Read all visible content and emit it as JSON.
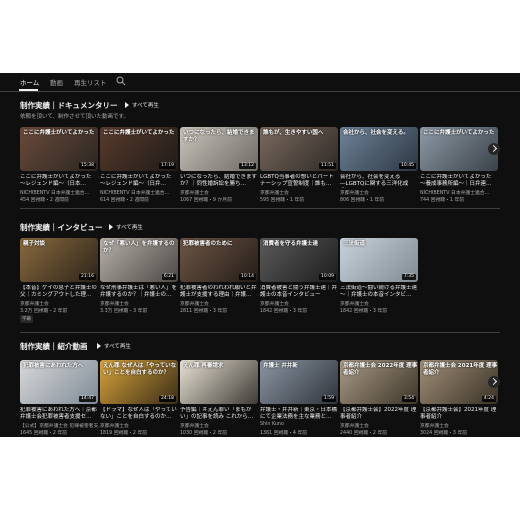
{
  "tabs": [
    {
      "label": "ホーム"
    },
    {
      "label": "動画"
    },
    {
      "label": "再生リスト"
    }
  ],
  "play_all_label": "すべて再生",
  "sections": [
    {
      "title": "制作実績｜ドキュメンタリー",
      "description": "依頼を頂いて、制作させて頂いた動画です。",
      "videos": [
        {
          "thumb_text": "ここに弁護士がいてよかった",
          "duration": "15:38",
          "title": "ここに弁護士がいてよかった ～レジェンド編～（日本…",
          "channel": "NICHIBENTV 日本弁護士連合…",
          "meta": "454 回視聴・2 週間前",
          "colors": [
            "#6b4a3a",
            "#2a2622"
          ]
        },
        {
          "thumb_text": "ここに弁護士がいてよかった",
          "duration": "17:19",
          "title": "ここに弁護士がいてよかった ～レジェンド編～（日弁…",
          "channel": "NICHIBENTV 日本弁護士連合…",
          "meta": "614 回視聴・2 週間前",
          "colors": [
            "#5a3b2c",
            "#1e1b19"
          ]
        },
        {
          "thumb_text": "いつになったら、結婚できますか？",
          "duration": "13:12",
          "title": "いつになったら、結婚できますか？｜同性婚訴訟を勝ち…",
          "channel": "京都弁護士会",
          "meta": "1067 回視聴・9 か月前",
          "colors": [
            "#c9c4bb",
            "#6d6a66"
          ]
        },
        {
          "thumb_text": "誰もが、生きやすい国へ",
          "duration": "11:51",
          "title": "LGBTQ当事者の想いとパートナーシップ宣誓制度｜誰も…",
          "channel": "京都弁護士会",
          "meta": "595 回視聴・1 年前",
          "colors": [
            "#7a6a5e",
            "#2f2a27"
          ]
        },
        {
          "thumb_text": "会社から、社会を変える。",
          "duration": "10:45",
          "title": "会社から、社会を変える―LGBTQに関する三洋化成の…",
          "channel": "京都弁護士会",
          "meta": "806 回視聴・1 年前",
          "colors": [
            "#6f8399",
            "#2c3642"
          ]
        },
        {
          "thumb_text": "ここに弁護士がいてよかった",
          "duration": "",
          "title": "ここに弁護士がいてよかった ～養成事務所編～｜日弁連…",
          "channel": "NICHIBENTV 日本弁護士連合…",
          "meta": "744 回視聴・1 年前",
          "colors": [
            "#8d9aa6",
            "#3a4148"
          ]
        }
      ]
    },
    {
      "title": "制作実績｜インタビュー",
      "description": "",
      "videos": [
        {
          "thumb_text": "親子対談",
          "duration": "21:16",
          "title": "【本音】ゲイの息子と弁護士の父｜カミングアウトした理…",
          "channel": "京都弁護士会",
          "meta": "3.2万 回視聴・2 年前",
          "badge": "字幕",
          "colors": [
            "#8a6a3f",
            "#2c241a"
          ]
        },
        {
          "thumb_text": "なぜ「悪い人」を弁護するのか？",
          "duration": "6:21",
          "title": "なぜ刑事弁護士は「悪い人」を弁護するのか？｜弁護士の…",
          "channel": "京都弁護士会",
          "meta": "3.3万 回視聴・3 年前",
          "colors": [
            "#b7b1aa",
            "#4c4844"
          ]
        },
        {
          "thumb_text": "犯罪被害者のために",
          "duration": "10:14",
          "title": "犯罪被害者のわれわれ願いと弁護士が支援する理由｜弁護…",
          "channel": "京都弁護士会",
          "meta": "2811 回視聴・3 年前",
          "colors": [
            "#6e5646",
            "#241d18"
          ]
        },
        {
          "thumb_text": "消費者を守る弁護士達",
          "duration": "10:09",
          "title": "消費者被害と闘う弁護士達｜弁護士の本音インタビュー",
          "channel": "京都弁護士会",
          "meta": "1842 回視聴・3 年前",
          "colors": [
            "#5b5b5b",
            "#1d1d1d"
          ]
        },
        {
          "thumb_text": "三法街道",
          "duration": "7:35",
          "title": "三法街道～闘い続ける弁護士達～｜弁護士の本音インタビ…",
          "channel": "京都弁護士会",
          "meta": "1842 回視聴・3 年前",
          "colors": [
            "#c9d3dc",
            "#7f8a93"
          ]
        }
      ]
    },
    {
      "title": "制作実績｜紹介動画",
      "description": "",
      "videos": [
        {
          "thumb_text": "犯罪被害にあわれた方へ",
          "duration": "14:47",
          "title": "犯罪被害にあわれた方へ｜京都弁護士会犯罪被害者支援セ…",
          "channel": "【公式】京都弁護士会 犯罪被害者支…",
          "meta": "1645 回視聴・2 年前",
          "colors": [
            "#d9d9d9",
            "#7e8a96"
          ]
        },
        {
          "thumb_text": "えん罪 なぜ人は「やっていない」ことを自白するのか？",
          "duration": "24:18",
          "title": "【ドラマ】なぜ人は「やっていない」ことを自白するのか…",
          "channel": "京都弁護士会",
          "meta": "1819 回視聴・2 年前",
          "colors": [
            "#d8a43b",
            "#3a2d17"
          ]
        },
        {
          "thumb_text": "えん罪 再審請求",
          "duration": "",
          "title": "予告編｜＃えん罪い「まもがい」の記事を読み これから…",
          "channel": "京都弁護士会",
          "meta": "1030 回視聴・2 年前",
          "colors": [
            "#e8e2d4",
            "#3f3b36"
          ]
        },
        {
          "thumb_text": "弁護士 井井新",
          "duration": "1:59",
          "title": "弁護士・井井新｜東京・日本橋にて企業法務を主な業務と…",
          "channel": "Shin Kuno",
          "meta": "1361 回視聴・4 年前",
          "colors": [
            "#8b95a3",
            "#2f343b"
          ]
        },
        {
          "thumb_text": "京都弁護士会 2022年度 理事者紹介",
          "duration": "3:54",
          "title": "【京都弁護士会】2022年度 理事者紹介",
          "channel": "京都弁護士会",
          "meta": "2440 回視聴・2 年前",
          "colors": [
            "#a99a86",
            "#3d3529"
          ]
        },
        {
          "thumb_text": "京都弁護士会 2021年度 理事者紹介",
          "duration": "4:24",
          "title": "【京都弁護士会】2021年度 理事者紹介",
          "channel": "京都弁護士会",
          "meta": "3024 回視聴・3 年前",
          "colors": [
            "#a08f78",
            "#3a3226"
          ]
        }
      ]
    }
  ]
}
